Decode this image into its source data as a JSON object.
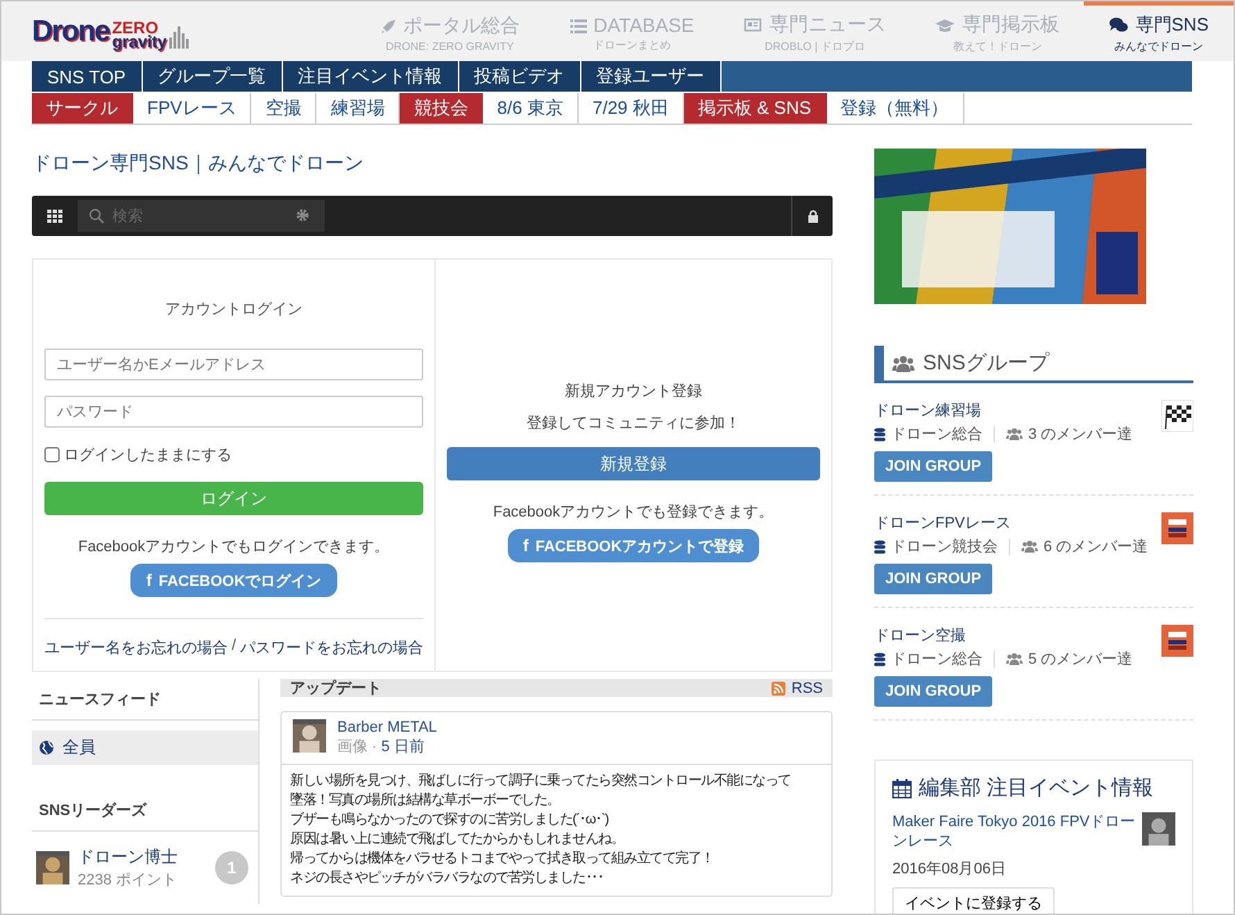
{
  "header": {
    "logo": {
      "main": "Drone",
      "top": "ZERO",
      "bottom": "gravity"
    },
    "portals": [
      {
        "title": "ポータル総合",
        "subtitle": "DRONE: ZERO GRAVITY",
        "selected": false
      },
      {
        "title": "DATABASE",
        "subtitle": "ドローンまとめ",
        "selected": false
      },
      {
        "title": "専門ニュース",
        "subtitle": "DROBLO | ドロブロ",
        "selected": false
      },
      {
        "title": "専門掲示板",
        "subtitle": "教えて！ドローン",
        "selected": false
      },
      {
        "title": "専門SNS",
        "subtitle": "みんなでドローン",
        "selected": true
      }
    ]
  },
  "menu": [
    "SNS TOP",
    "グループ一覧",
    "注目イベント情報",
    "投稿ビデオ",
    "登録ユーザー"
  ],
  "tags": [
    {
      "label": "サークル",
      "featured": true
    },
    {
      "label": "FPVレース",
      "featured": false
    },
    {
      "label": "空撮",
      "featured": false
    },
    {
      "label": "練習場",
      "featured": false
    },
    {
      "label": "競技会",
      "featured": true
    },
    {
      "label": "8/6 東京",
      "featured": false
    },
    {
      "label": "7/29 秋田",
      "featured": false
    },
    {
      "label": "掲示板 & SNS",
      "featured": true
    },
    {
      "label": "登録（無料）",
      "featured": false
    }
  ],
  "page_title": "ドローン専門SNS｜みんなでドローン",
  "toolbar": {
    "search": {
      "placeholder": "検索"
    }
  },
  "login": {
    "title": "アカウントログイン",
    "username": {
      "placeholder": "ユーザー名かEメールアドレス"
    },
    "password": {
      "placeholder": "パスワード"
    },
    "remember": {
      "label": "ログインしたままにする",
      "checked": false
    },
    "button": "ログイン",
    "facebook_note": "Facebookアカウントでもログインできます。",
    "facebook_button": {
      "icon": "f",
      "label": "FACEBOOKでログイン"
    },
    "forgot_username": "ユーザー名をお忘れの場合",
    "separator": "/",
    "forgot_password": "パスワードをお忘れの場合"
  },
  "signup": {
    "title": "新規アカウント登録",
    "subtitle": "登録してコミュニティに参加！",
    "button": "新規登録",
    "facebook_note": "Facebookアカウントでも登録できます。",
    "facebook_button": {
      "icon": "f",
      "label": "FACEBOOKアカウントで登録"
    }
  },
  "sidebar": {
    "feed_heading": "ニュースフィード",
    "feed_items": [
      {
        "label": "全員",
        "selected": true
      }
    ],
    "leaders_heading": "SNSリーダーズ",
    "leaders": [
      {
        "name": "ドローン博士",
        "points": "2238 ポイント",
        "rank": "1"
      }
    ]
  },
  "updates": {
    "heading": "アップデート",
    "rss": "RSS",
    "posts": [
      {
        "author": "Barber METAL",
        "type": "画像 ·",
        "time": "5 日前",
        "lines": [
          "新しい場所を見つけ、飛ばしに行って調子に乗ってたら突然コントロール不能になって",
          "墜落！写真の場所は結構な草ボーボーでした。",
          "ブザーも鳴らなかったので探すのに苦労しました(´･ω･`)",
          "原因は暑い上に連続で飛ばしてたからかもしれませんね。",
          "帰ってからは機体をバラせるトコまでやって拭き取って組み立てて完了！",
          "ネジの長さやピッチがバラバラなので苦労しました･･･"
        ]
      }
    ]
  },
  "groups": {
    "heading": "SNSグループ",
    "items": [
      {
        "name": "ドローン練習場",
        "category": "ドローン総合",
        "members": "3 のメンバー達",
        "kind": "flag",
        "button": "JOIN GROUP"
      },
      {
        "name": "ドローンFPVレース",
        "category": "ドローン競技会",
        "members": "6 のメンバー達",
        "kind": "logo",
        "button": "JOIN GROUP"
      },
      {
        "name": "ドローン空撮",
        "category": "ドローン総合",
        "members": "5 のメンバー達",
        "kind": "logo",
        "button": "JOIN GROUP"
      }
    ]
  },
  "events": {
    "heading": "編集部 注目イベント情報",
    "items": [
      {
        "title": "Maker Faire Tokyo 2016 FPVドローンレース",
        "date": "2016年08月06日",
        "button": "イベントに登録する"
      }
    ]
  }
}
